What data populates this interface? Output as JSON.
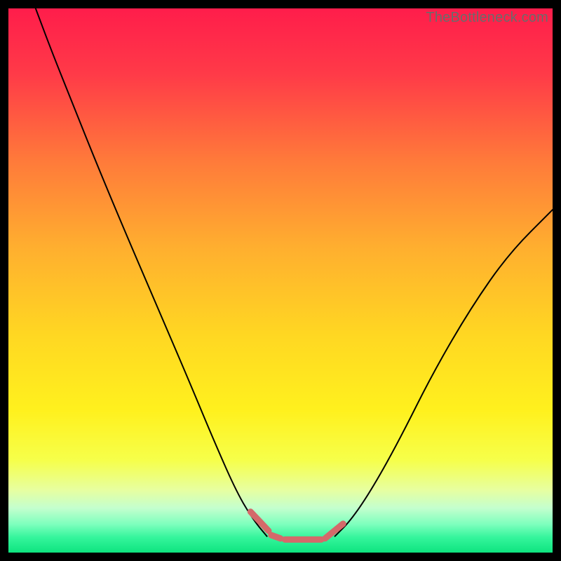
{
  "watermark": "TheBottleneck.com",
  "chart_data": {
    "type": "line",
    "title": "",
    "xlabel": "",
    "ylabel": "",
    "xlim": [
      0,
      100
    ],
    "ylim": [
      0,
      100
    ],
    "grid": false,
    "legend": false,
    "background": {
      "kind": "vertical-gradient",
      "stops": [
        {
          "pos": 0.0,
          "color": "#ff1d4b"
        },
        {
          "pos": 0.12,
          "color": "#ff3a48"
        },
        {
          "pos": 0.28,
          "color": "#ff7a3a"
        },
        {
          "pos": 0.44,
          "color": "#ffaf2f"
        },
        {
          "pos": 0.6,
          "color": "#ffd722"
        },
        {
          "pos": 0.74,
          "color": "#fff11e"
        },
        {
          "pos": 0.83,
          "color": "#f6ff4a"
        },
        {
          "pos": 0.885,
          "color": "#e7ffa0"
        },
        {
          "pos": 0.918,
          "color": "#c4ffce"
        },
        {
          "pos": 0.948,
          "color": "#7dffbd"
        },
        {
          "pos": 0.972,
          "color": "#35f59c"
        },
        {
          "pos": 1.0,
          "color": "#0ee47f"
        }
      ]
    },
    "series": [
      {
        "name": "bottleneck-curve-left",
        "color": "#000000",
        "stroke_width": 2,
        "x": [
          5,
          8,
          12,
          16,
          21,
          27,
          33,
          38,
          42,
          45,
          47.5
        ],
        "y": [
          100,
          92,
          82,
          72,
          60,
          46,
          32,
          20,
          11,
          6,
          3
        ]
      },
      {
        "name": "bottleneck-curve-right",
        "color": "#000000",
        "stroke_width": 2,
        "x": [
          60,
          63,
          67,
          72,
          78,
          85,
          92,
          100
        ],
        "y": [
          3,
          6,
          12,
          21,
          33,
          45,
          55,
          63
        ]
      },
      {
        "name": "optimal-zone",
        "color": "#d46a6a",
        "stroke_width": 9,
        "cap": "round",
        "segments": [
          {
            "x": [
              44.5,
              47.8
            ],
            "y": [
              7.5,
              4.0
            ]
          },
          {
            "x": [
              48.3,
              50.0
            ],
            "y": [
              3.2,
              2.6
            ]
          },
          {
            "x": [
              50.8,
              57.5
            ],
            "y": [
              2.4,
              2.4
            ]
          },
          {
            "x": [
              58.2,
              61.5
            ],
            "y": [
              2.6,
              5.3
            ]
          }
        ]
      }
    ]
  }
}
